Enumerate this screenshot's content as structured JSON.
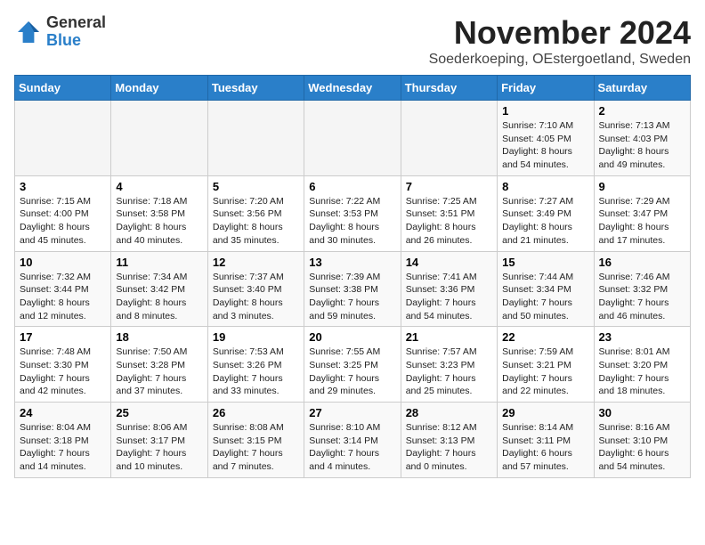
{
  "header": {
    "logo_line1": "General",
    "logo_line2": "Blue",
    "month_title": "November 2024",
    "location": "Soederkoeping, OEstergoetland, Sweden"
  },
  "weekdays": [
    "Sunday",
    "Monday",
    "Tuesday",
    "Wednesday",
    "Thursday",
    "Friday",
    "Saturday"
  ],
  "weeks": [
    [
      {
        "day": "",
        "info": ""
      },
      {
        "day": "",
        "info": ""
      },
      {
        "day": "",
        "info": ""
      },
      {
        "day": "",
        "info": ""
      },
      {
        "day": "",
        "info": ""
      },
      {
        "day": "1",
        "info": "Sunrise: 7:10 AM\nSunset: 4:05 PM\nDaylight: 8 hours\nand 54 minutes."
      },
      {
        "day": "2",
        "info": "Sunrise: 7:13 AM\nSunset: 4:03 PM\nDaylight: 8 hours\nand 49 minutes."
      }
    ],
    [
      {
        "day": "3",
        "info": "Sunrise: 7:15 AM\nSunset: 4:00 PM\nDaylight: 8 hours\nand 45 minutes."
      },
      {
        "day": "4",
        "info": "Sunrise: 7:18 AM\nSunset: 3:58 PM\nDaylight: 8 hours\nand 40 minutes."
      },
      {
        "day": "5",
        "info": "Sunrise: 7:20 AM\nSunset: 3:56 PM\nDaylight: 8 hours\nand 35 minutes."
      },
      {
        "day": "6",
        "info": "Sunrise: 7:22 AM\nSunset: 3:53 PM\nDaylight: 8 hours\nand 30 minutes."
      },
      {
        "day": "7",
        "info": "Sunrise: 7:25 AM\nSunset: 3:51 PM\nDaylight: 8 hours\nand 26 minutes."
      },
      {
        "day": "8",
        "info": "Sunrise: 7:27 AM\nSunset: 3:49 PM\nDaylight: 8 hours\nand 21 minutes."
      },
      {
        "day": "9",
        "info": "Sunrise: 7:29 AM\nSunset: 3:47 PM\nDaylight: 8 hours\nand 17 minutes."
      }
    ],
    [
      {
        "day": "10",
        "info": "Sunrise: 7:32 AM\nSunset: 3:44 PM\nDaylight: 8 hours\nand 12 minutes."
      },
      {
        "day": "11",
        "info": "Sunrise: 7:34 AM\nSunset: 3:42 PM\nDaylight: 8 hours\nand 8 minutes."
      },
      {
        "day": "12",
        "info": "Sunrise: 7:37 AM\nSunset: 3:40 PM\nDaylight: 8 hours\nand 3 minutes."
      },
      {
        "day": "13",
        "info": "Sunrise: 7:39 AM\nSunset: 3:38 PM\nDaylight: 7 hours\nand 59 minutes."
      },
      {
        "day": "14",
        "info": "Sunrise: 7:41 AM\nSunset: 3:36 PM\nDaylight: 7 hours\nand 54 minutes."
      },
      {
        "day": "15",
        "info": "Sunrise: 7:44 AM\nSunset: 3:34 PM\nDaylight: 7 hours\nand 50 minutes."
      },
      {
        "day": "16",
        "info": "Sunrise: 7:46 AM\nSunset: 3:32 PM\nDaylight: 7 hours\nand 46 minutes."
      }
    ],
    [
      {
        "day": "17",
        "info": "Sunrise: 7:48 AM\nSunset: 3:30 PM\nDaylight: 7 hours\nand 42 minutes."
      },
      {
        "day": "18",
        "info": "Sunrise: 7:50 AM\nSunset: 3:28 PM\nDaylight: 7 hours\nand 37 minutes."
      },
      {
        "day": "19",
        "info": "Sunrise: 7:53 AM\nSunset: 3:26 PM\nDaylight: 7 hours\nand 33 minutes."
      },
      {
        "day": "20",
        "info": "Sunrise: 7:55 AM\nSunset: 3:25 PM\nDaylight: 7 hours\nand 29 minutes."
      },
      {
        "day": "21",
        "info": "Sunrise: 7:57 AM\nSunset: 3:23 PM\nDaylight: 7 hours\nand 25 minutes."
      },
      {
        "day": "22",
        "info": "Sunrise: 7:59 AM\nSunset: 3:21 PM\nDaylight: 7 hours\nand 22 minutes."
      },
      {
        "day": "23",
        "info": "Sunrise: 8:01 AM\nSunset: 3:20 PM\nDaylight: 7 hours\nand 18 minutes."
      }
    ],
    [
      {
        "day": "24",
        "info": "Sunrise: 8:04 AM\nSunset: 3:18 PM\nDaylight: 7 hours\nand 14 minutes."
      },
      {
        "day": "25",
        "info": "Sunrise: 8:06 AM\nSunset: 3:17 PM\nDaylight: 7 hours\nand 10 minutes."
      },
      {
        "day": "26",
        "info": "Sunrise: 8:08 AM\nSunset: 3:15 PM\nDaylight: 7 hours\nand 7 minutes."
      },
      {
        "day": "27",
        "info": "Sunrise: 8:10 AM\nSunset: 3:14 PM\nDaylight: 7 hours\nand 4 minutes."
      },
      {
        "day": "28",
        "info": "Sunrise: 8:12 AM\nSunset: 3:13 PM\nDaylight: 7 hours\nand 0 minutes."
      },
      {
        "day": "29",
        "info": "Sunrise: 8:14 AM\nSunset: 3:11 PM\nDaylight: 6 hours\nand 57 minutes."
      },
      {
        "day": "30",
        "info": "Sunrise: 8:16 AM\nSunset: 3:10 PM\nDaylight: 6 hours\nand 54 minutes."
      }
    ]
  ]
}
